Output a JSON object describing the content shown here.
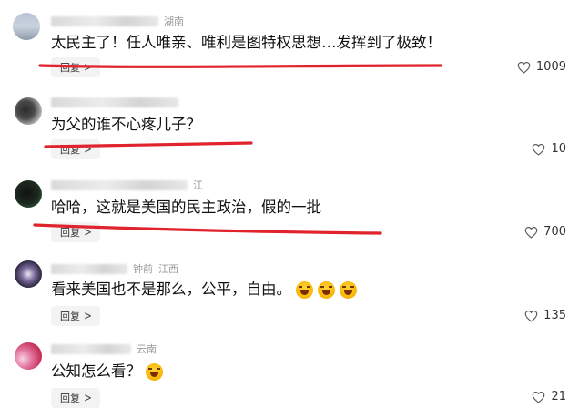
{
  "accent": {
    "underline": "#e0232c"
  },
  "comments": [
    {
      "meta_location": "湖南",
      "text": "太民主了！任人唯亲、唯利是图特权思想…发挥到了极致！",
      "reply_label": "回复",
      "likes": "1009",
      "emojis": []
    },
    {
      "meta_location": "",
      "text": "为父的谁不心疼儿子？",
      "reply_label": "回复",
      "likes": "10",
      "emojis": []
    },
    {
      "meta_location": "江",
      "text": "哈哈，这就是美国的民主政治，假的一批",
      "reply_label": "回复",
      "likes": "700",
      "emojis": []
    },
    {
      "meta_time": "钟前",
      "meta_location": "江西",
      "text": "看来美国也不是那么，公平，自由。",
      "reply_label": "回复",
      "likes": "135",
      "emojis": [
        "laughing-crying-emoji",
        "laughing-crying-emoji",
        "laughing-crying-emoji"
      ]
    },
    {
      "meta_location": "云南",
      "text": "公知怎么看？",
      "reply_label": "回复",
      "likes": "21",
      "emojis": [
        "laughing-crying-emoji"
      ]
    }
  ]
}
